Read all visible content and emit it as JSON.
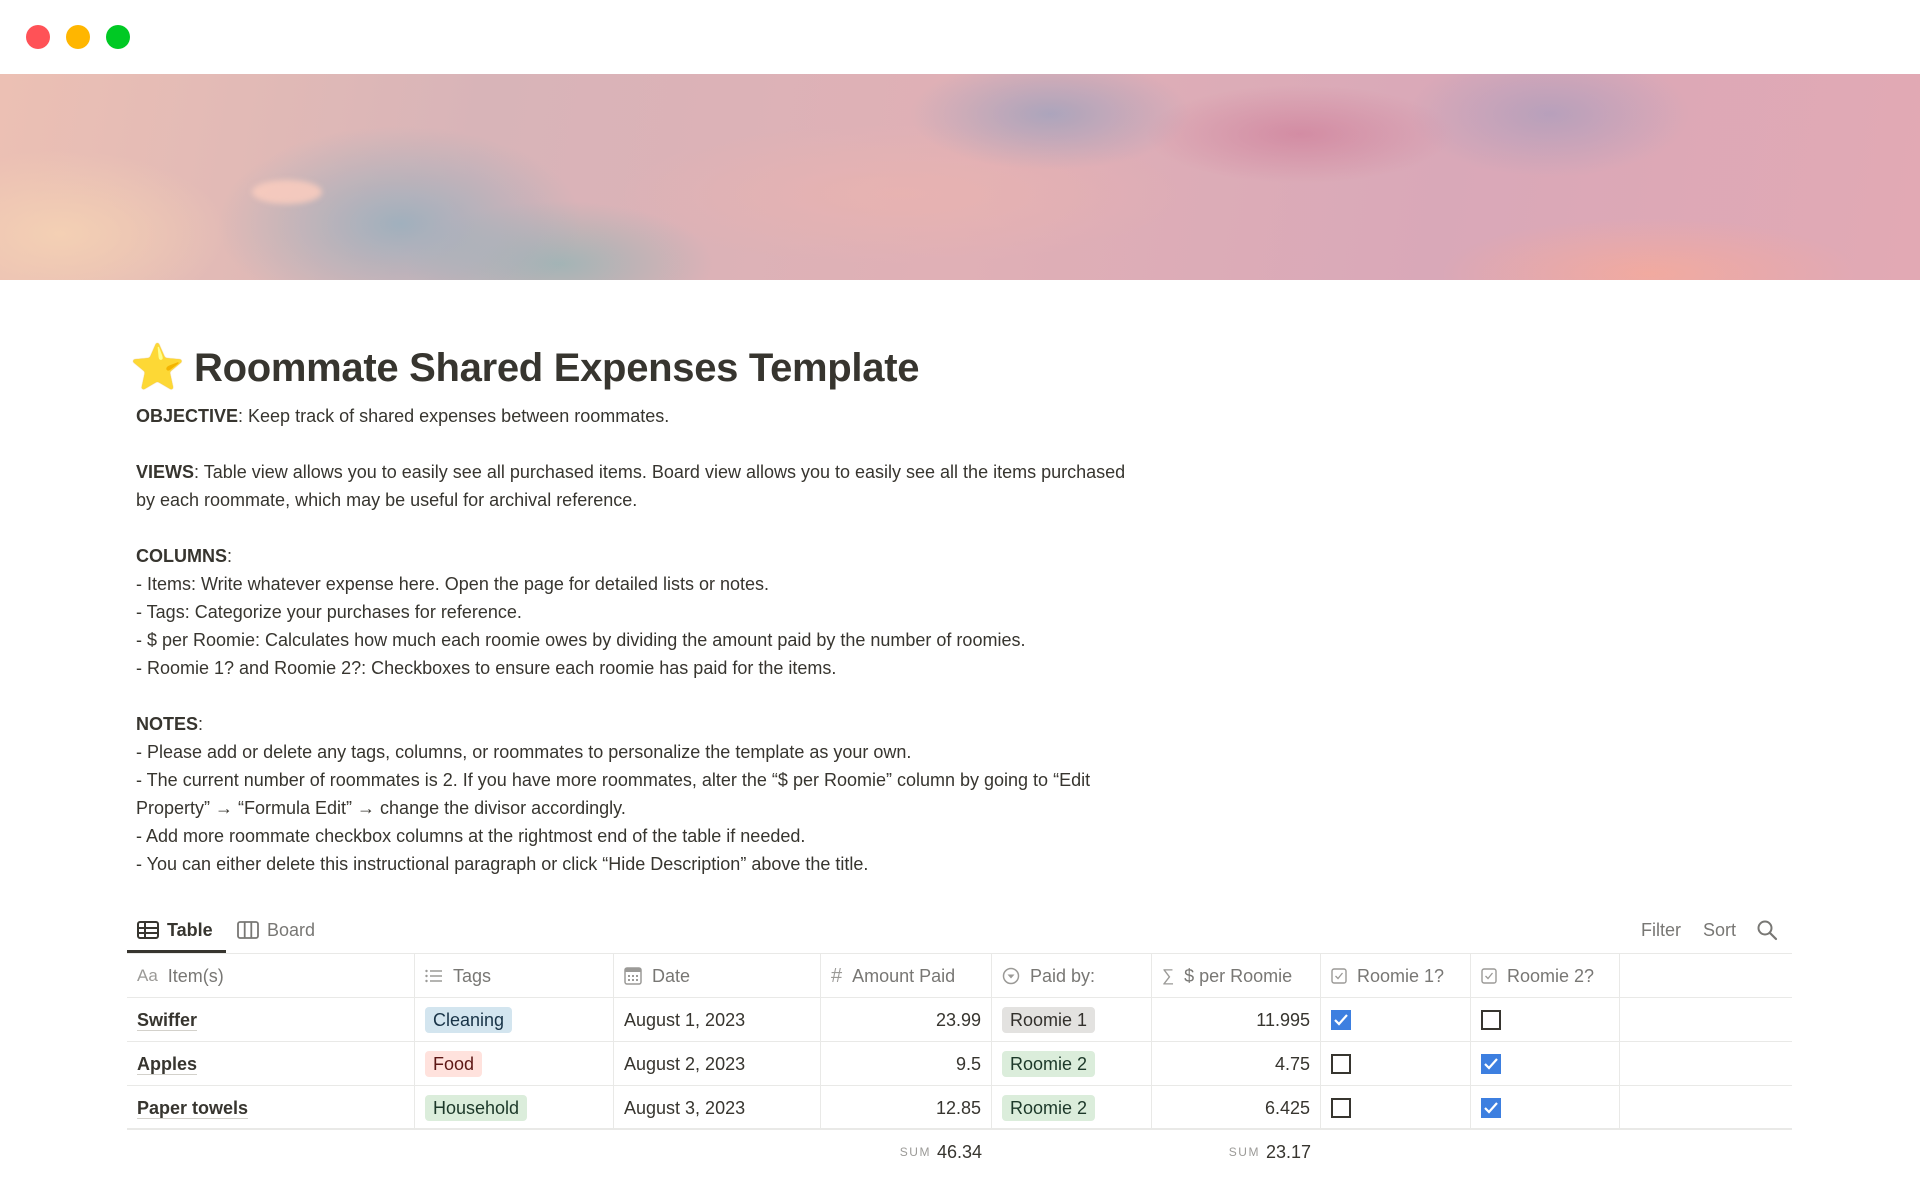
{
  "window": {
    "controls": [
      "close",
      "minimize",
      "zoom"
    ]
  },
  "page": {
    "icon": "star-emoji",
    "icon_glyph": "⭐",
    "title": "Roommate Shared Expenses Template"
  },
  "description": {
    "objective_label": "OBJECTIVE",
    "objective_text": ": Keep track of shared expenses between roommates.",
    "views_label": "VIEWS",
    "views_text": ": Table view allows you to easily see all purchased items. Board view allows you to easily see all the items purchased by each roommate, which may be useful for archival reference.",
    "columns_label": "COLUMNS",
    "columns_colon": ":",
    "columns_lines": [
      "- Items: Write whatever expense here. Open the page for detailed lists or notes.",
      "- Tags: Categorize your purchases for reference.",
      "- $ per Roomie: Calculates how much each roomie owes by dividing the amount paid by the number of roomies.",
      "- Roomie 1? and Roomie 2?: Checkboxes to ensure each roomie has paid for the items."
    ],
    "notes_label": "NOTES",
    "notes_colon": ":",
    "notes_lines": [
      "- Please add or delete any tags, columns, or roommates to personalize the template as your own.",
      "- The current number of roommates is 2. If you have more roommates, alter the “$ per Roomie” column by going to “Edit Property” → “Formula Edit” → change the divisor accordingly.",
      "- Add more roommate checkbox columns at the rightmost end of the table if needed.",
      "- You can either delete this instructional paragraph or click “Hide Description” above the title."
    ]
  },
  "views": {
    "tabs": [
      {
        "label": "Table",
        "icon": "table-icon",
        "active": true
      },
      {
        "label": "Board",
        "icon": "board-icon",
        "active": false
      }
    ],
    "filter_label": "Filter",
    "sort_label": "Sort",
    "search_icon": "search-icon"
  },
  "table": {
    "columns": [
      {
        "label": "Item(s)",
        "icon": "Aa",
        "type": "title"
      },
      {
        "label": "Tags",
        "icon": "list-icon",
        "type": "multi-select"
      },
      {
        "label": "Date",
        "icon": "calendar-icon",
        "type": "date"
      },
      {
        "label": "Amount Paid",
        "icon": "#",
        "type": "number"
      },
      {
        "label": "Paid by:",
        "icon": "select-icon",
        "type": "select"
      },
      {
        "label": "$ per Roomie",
        "icon": "∑",
        "type": "formula"
      },
      {
        "label": "Roomie 1?",
        "icon": "checkbox-icon",
        "type": "checkbox"
      },
      {
        "label": "Roomie 2?",
        "icon": "checkbox-icon",
        "type": "checkbox"
      }
    ],
    "rows": [
      {
        "item": "Swiffer",
        "tag": "Cleaning",
        "tag_color": "blue",
        "date": "August 1, 2023",
        "amount": "23.99",
        "paid_by": "Roomie 1",
        "paid_by_color": "gray",
        "per_roomie": "11.995",
        "roomie1": true,
        "roomie2": false
      },
      {
        "item": "Apples",
        "tag": "Food",
        "tag_color": "red",
        "date": "August 2, 2023",
        "amount": "9.5",
        "paid_by": "Roomie 2",
        "paid_by_color": "green",
        "per_roomie": "4.75",
        "roomie1": false,
        "roomie2": true
      },
      {
        "item": "Paper towels",
        "tag": "Household",
        "tag_color": "green",
        "date": "August 3, 2023",
        "amount": "12.85",
        "paid_by": "Roomie 2",
        "paid_by_color": "green",
        "per_roomie": "6.425",
        "roomie1": false,
        "roomie2": true
      }
    ],
    "footer": {
      "amount_sum_label": "SUM",
      "amount_sum": "46.34",
      "per_roomie_sum_label": "SUM",
      "per_roomie_sum": "23.17"
    }
  },
  "colors": {
    "checkbox_checked": "#3d7fe0",
    "text": "#37352f",
    "muted": "#787774"
  }
}
